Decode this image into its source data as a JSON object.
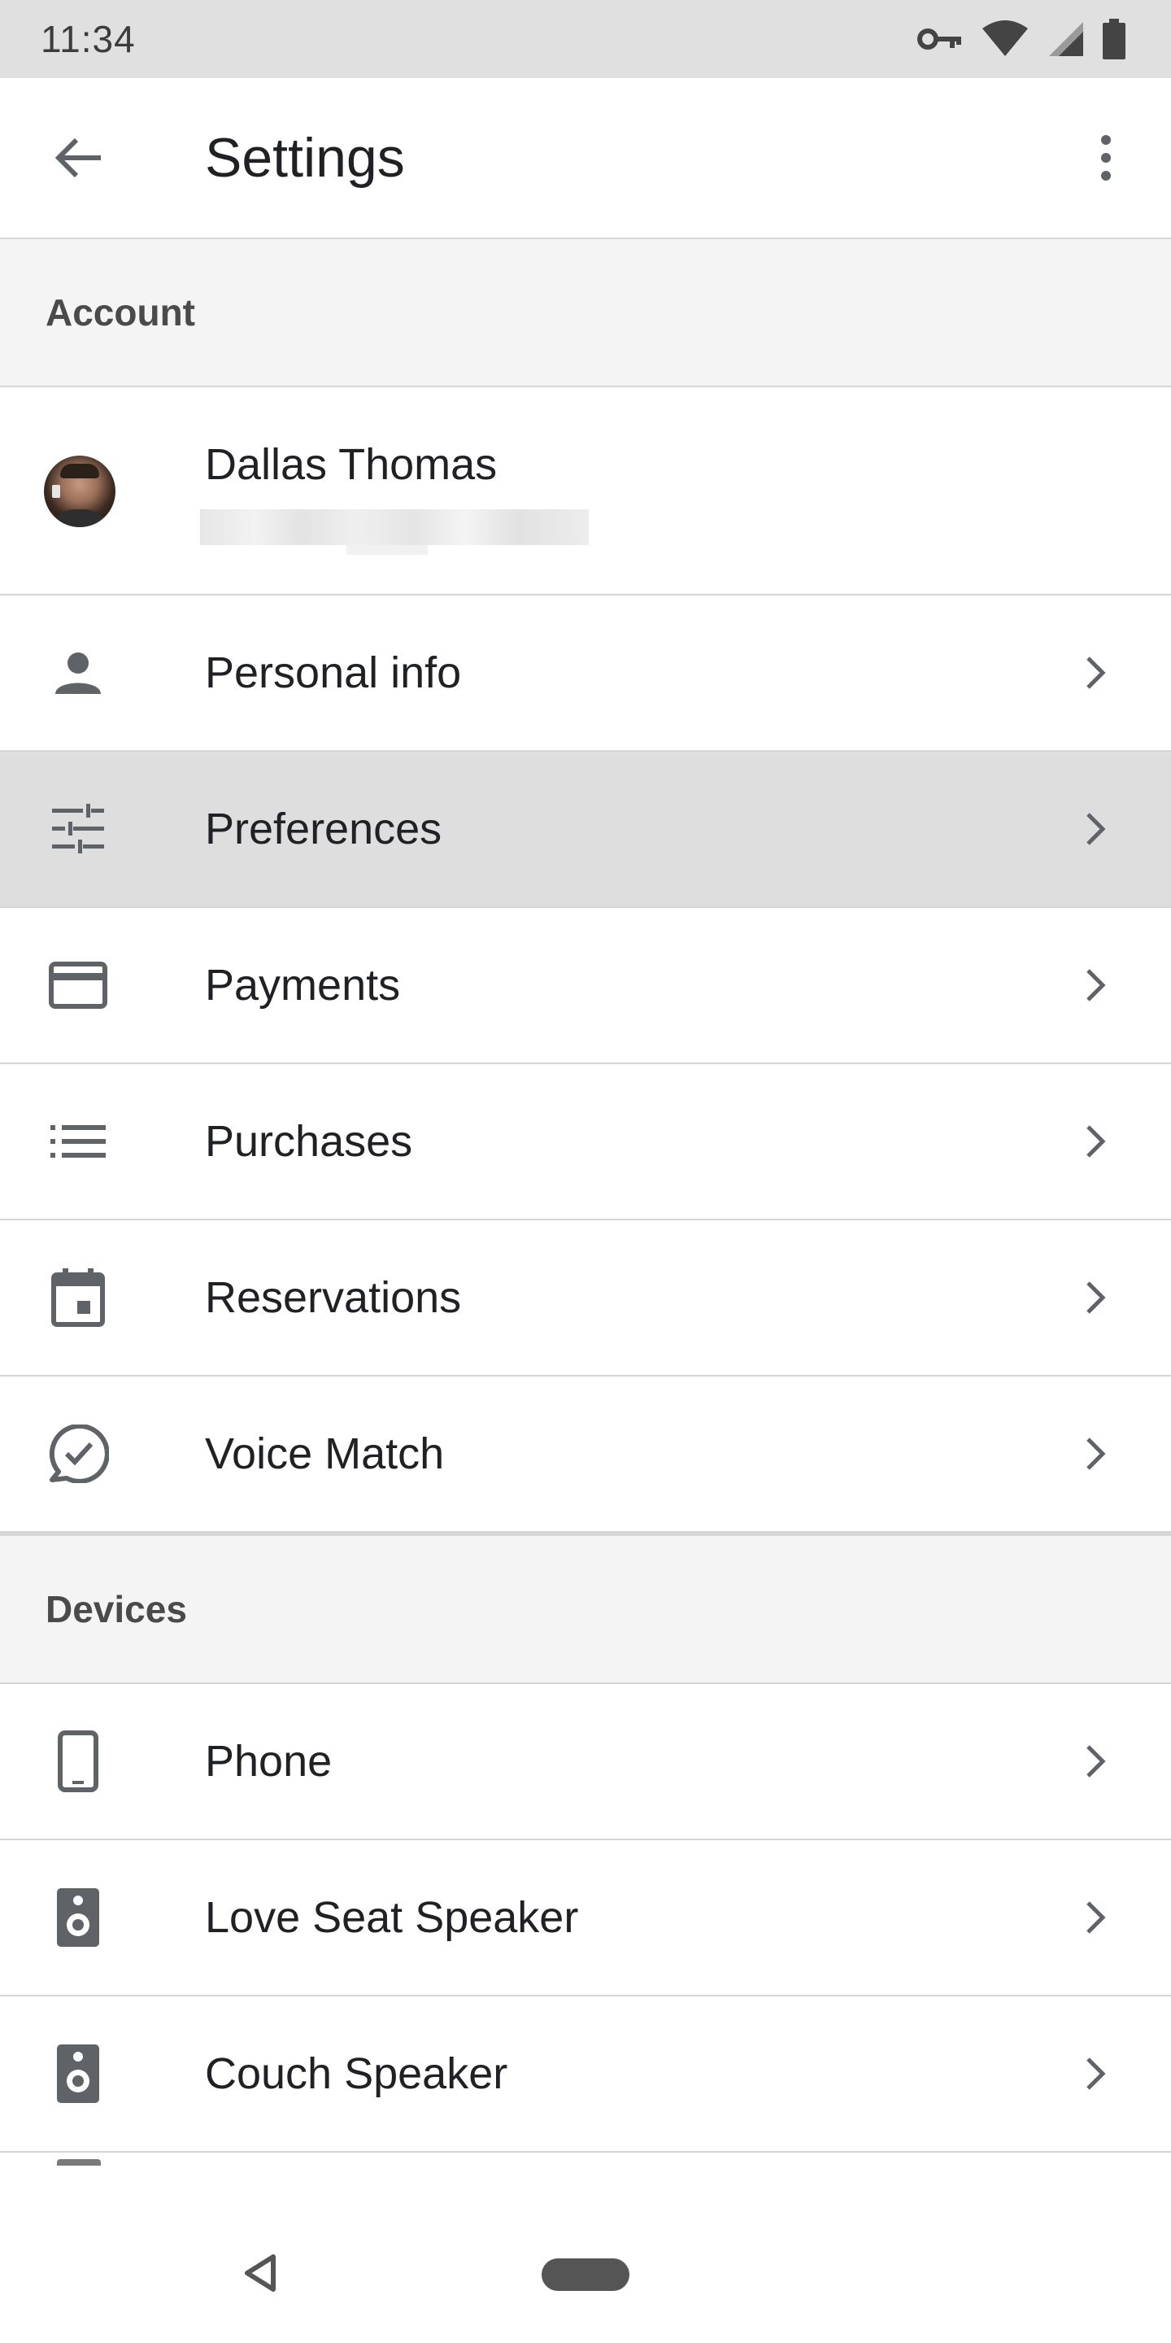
{
  "status_bar": {
    "time": "11:34",
    "icons": [
      "vpn-key-icon",
      "wifi-icon",
      "signal-icon",
      "battery-icon"
    ]
  },
  "app_bar": {
    "title": "Settings",
    "back_icon": "arrow-back-icon",
    "more_icon": "more-vert-icon"
  },
  "sections": {
    "account": {
      "header": "Account"
    },
    "devices": {
      "header": "Devices"
    }
  },
  "account": {
    "name": "Dallas Thomas"
  },
  "account_items": [
    {
      "label": "Personal info",
      "icon": "person-icon"
    },
    {
      "label": "Preferences",
      "icon": "tune-icon",
      "highlighted": true
    },
    {
      "label": "Payments",
      "icon": "credit-card-icon"
    },
    {
      "label": "Purchases",
      "icon": "list-icon"
    },
    {
      "label": "Reservations",
      "icon": "calendar-icon"
    },
    {
      "label": "Voice Match",
      "icon": "voice-match-icon"
    }
  ],
  "device_items": [
    {
      "label": "Phone",
      "icon": "phone-icon"
    },
    {
      "label": "Love Seat Speaker",
      "icon": "speaker-icon"
    },
    {
      "label": "Couch Speaker",
      "icon": "speaker-icon"
    }
  ],
  "colors": {
    "status_bar_bg": "#e0e0e0",
    "section_bg": "#f4f4f4",
    "highlight_bg": "#dedede",
    "icon_gray": "#5f6368",
    "text": "#202124"
  },
  "nav_bar": {
    "back_icon": "nav-back-triangle-icon",
    "home_icon": "nav-home-pill-icon"
  }
}
